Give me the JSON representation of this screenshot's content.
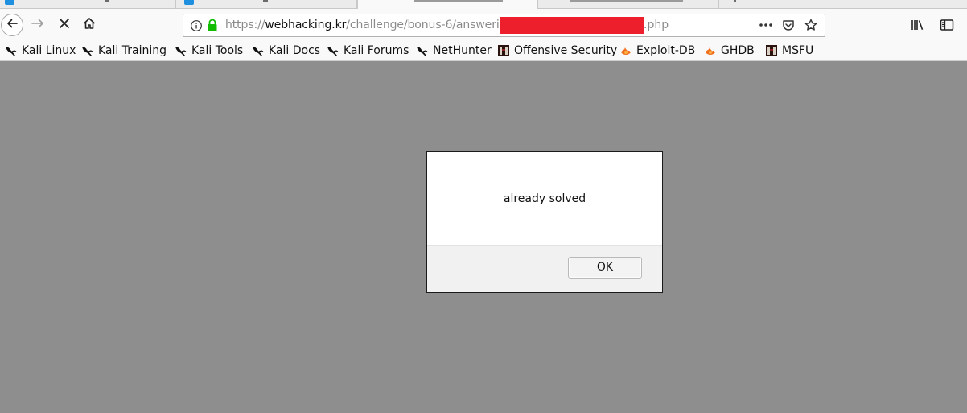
{
  "browser": {
    "url": {
      "scheme": "https://",
      "domain": "webhacking.kr",
      "path": "/challenge/bonus-6/answerip/",
      "suffix": ".php"
    },
    "icons": {
      "back": "arrow-left-icon",
      "forward": "arrow-right-icon",
      "stop": "close-icon",
      "home": "home-icon",
      "info": "info-icon",
      "lock": "lock-icon",
      "page_actions": "ellipsis-icon",
      "pocket": "pocket-icon",
      "bookmark_star": "star-icon",
      "library": "library-icon",
      "sidebar": "sidebar-icon"
    },
    "colors": {
      "redaction": "#ee1f2c",
      "lock_green": "#12bc00"
    }
  },
  "bookmarks": [
    {
      "label": "Kali Linux",
      "icon": "kali-dragon-icon"
    },
    {
      "label": "Kali Training",
      "icon": "kali-dragon-icon"
    },
    {
      "label": "Kali Tools",
      "icon": "kali-dragon-icon"
    },
    {
      "label": "Kali Docs",
      "icon": "kali-dragon-icon"
    },
    {
      "label": "Kali Forums",
      "icon": "kali-dragon-icon"
    },
    {
      "label": "NetHunter",
      "icon": "kali-dragon-icon"
    },
    {
      "label": "Offensive Security",
      "icon": "offsec-icon"
    },
    {
      "label": "Exploit-DB",
      "icon": "exploitdb-icon"
    },
    {
      "label": "GHDB",
      "icon": "exploitdb-icon"
    },
    {
      "label": "MSFU",
      "icon": "offsec-icon"
    }
  ],
  "dialog": {
    "message": "already solved",
    "ok_label": "OK"
  }
}
